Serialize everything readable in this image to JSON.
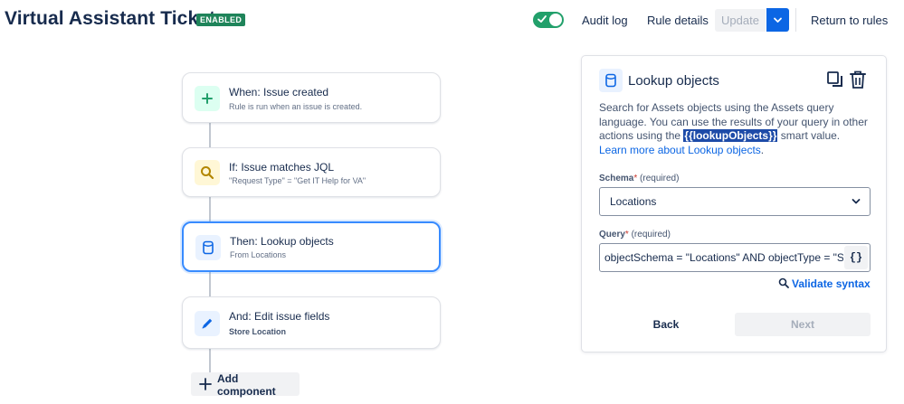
{
  "header": {
    "title": "Virtual Assistant Tickets",
    "status_badge": "ENABLED",
    "rule_enabled": true,
    "audit_log": "Audit log",
    "rule_details": "Rule details",
    "update": "Update",
    "return_to_rules": "Return to rules"
  },
  "flow": {
    "steps": [
      {
        "title": "When: Issue created",
        "subtitle": "Rule is run when an issue is created.",
        "icon": "plus-icon",
        "color": "#22a06b"
      },
      {
        "title": "If: Issue matches JQL",
        "subtitle": "\"Request Type\" = \"Get IT Help for VA\"",
        "icon": "search-icon",
        "color": "#cf9f02"
      },
      {
        "title": "Then: Lookup objects",
        "subtitle": "From Locations",
        "icon": "database-icon",
        "color": "#0c66e4"
      },
      {
        "title": "And: Edit issue fields",
        "subtitle": "Store Location",
        "icon": "pencil-icon",
        "color": "#0c66e4"
      }
    ],
    "add_component": "Add component"
  },
  "panel": {
    "title": "Lookup objects",
    "desc_part1": "Search for Assets objects using the Assets query language. You can use the results of your query in other actions using the ",
    "smart_value": "{{lookupObjects}}",
    "desc_part2": " smart value. ",
    "learn_more": "Learn more about Lookup objects",
    "desc_end": ".",
    "schema_label": "Schema",
    "query_label": "Query",
    "required_star": "*",
    "required_text": "(required)",
    "schema_value": "Locations",
    "query_value": "objectSchema = \"Locations\" AND objectType = \"Store",
    "braces": "{}",
    "validate": "Validate syntax",
    "back": "Back",
    "next": "Next"
  },
  "colors": {
    "accent": "#0c66e4",
    "enabled": "#1f845a",
    "toggle_on": "#22a06b"
  }
}
